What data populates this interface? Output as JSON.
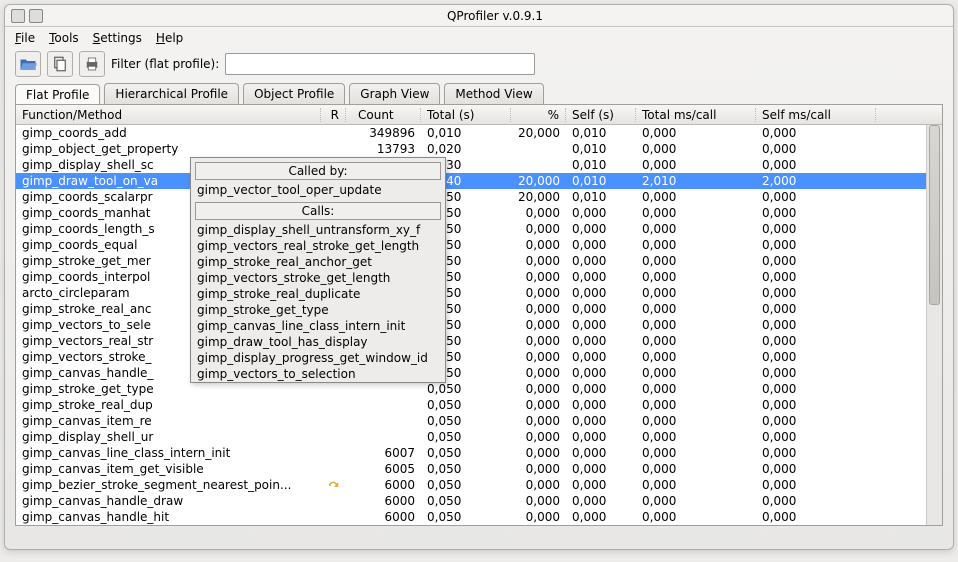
{
  "window": {
    "title": "QProfiler v.0.9.1"
  },
  "menu": {
    "file": "File",
    "tools": "Tools",
    "settings": "Settings",
    "help": "Help"
  },
  "toolbar": {
    "filter_label": "Filter (flat profile):",
    "filter_value": ""
  },
  "tabs": [
    {
      "label": "Flat Profile",
      "active": true
    },
    {
      "label": "Hierarchical Profile",
      "active": false
    },
    {
      "label": "Object Profile",
      "active": false
    },
    {
      "label": "Graph View",
      "active": false
    },
    {
      "label": "Method View",
      "active": false
    }
  ],
  "columns": [
    "Function/Method",
    "R",
    "Count",
    "Total (s)",
    "%",
    "Self (s)",
    "Total ms/call",
    "Self ms/call"
  ],
  "rows": [
    {
      "fn": "gimp_coords_add",
      "r": "",
      "count": "349896",
      "total": "0,010",
      "pct": "20,000",
      "self": "0,010",
      "tms": "0,000",
      "sms": "0,000",
      "sel": false
    },
    {
      "fn": "gimp_object_get_property",
      "r": "",
      "count": "13793",
      "total": "0,020",
      "pct": "",
      "self": "0,010",
      "tms": "0,000",
      "sms": "0,000",
      "sel": false
    },
    {
      "fn": "gimp_display_shell_sc",
      "r": "",
      "count": "",
      "total": "0,030",
      "pct": "",
      "self": "0,010",
      "tms": "0,000",
      "sms": "0,000",
      "sel": false
    },
    {
      "fn": "gimp_draw_tool_on_va",
      "r": "",
      "count": "",
      "total": "0,040",
      "pct": "20,000",
      "self": "0,010",
      "tms": "2,010",
      "sms": "2,000",
      "sel": true
    },
    {
      "fn": "gimp_coords_scalarpr",
      "r": "",
      "count": "",
      "total": "0,050",
      "pct": "20,000",
      "self": "0,010",
      "tms": "0,000",
      "sms": "0,000",
      "sel": false
    },
    {
      "fn": "gimp_coords_manhat",
      "r": "",
      "count": "",
      "total": "0,050",
      "pct": "0,000",
      "self": "0,000",
      "tms": "0,000",
      "sms": "0,000",
      "sel": false
    },
    {
      "fn": "gimp_coords_length_s",
      "r": "",
      "count": "",
      "total": "0,050",
      "pct": "0,000",
      "self": "0,000",
      "tms": "0,000",
      "sms": "0,000",
      "sel": false
    },
    {
      "fn": "gimp_coords_equal",
      "r": "",
      "count": "",
      "total": "0,050",
      "pct": "0,000",
      "self": "0,000",
      "tms": "0,000",
      "sms": "0,000",
      "sel": false
    },
    {
      "fn": "gimp_stroke_get_mer",
      "r": "",
      "count": "",
      "total": "0,050",
      "pct": "0,000",
      "self": "0,000",
      "tms": "0,000",
      "sms": "0,000",
      "sel": false
    },
    {
      "fn": "gimp_coords_interpol",
      "r": "",
      "count": "",
      "total": "0,050",
      "pct": "0,000",
      "self": "0,000",
      "tms": "0,000",
      "sms": "0,000",
      "sel": false
    },
    {
      "fn": "arcto_circleparam",
      "r": "",
      "count": "",
      "total": "0,050",
      "pct": "0,000",
      "self": "0,000",
      "tms": "0,000",
      "sms": "0,000",
      "sel": false
    },
    {
      "fn": "gimp_stroke_real_anc",
      "r": "",
      "count": "",
      "total": "0,050",
      "pct": "0,000",
      "self": "0,000",
      "tms": "0,000",
      "sms": "0,000",
      "sel": false
    },
    {
      "fn": "gimp_vectors_to_sele",
      "r": "",
      "count": "",
      "total": "0,050",
      "pct": "0,000",
      "self": "0,000",
      "tms": "0,000",
      "sms": "0,000",
      "sel": false
    },
    {
      "fn": "gimp_vectors_real_str",
      "r": "",
      "count": "",
      "total": "0,050",
      "pct": "0,000",
      "self": "0,000",
      "tms": "0,000",
      "sms": "0,000",
      "sel": false
    },
    {
      "fn": "gimp_vectors_stroke_",
      "r": "",
      "count": "",
      "total": "0,050",
      "pct": "0,000",
      "self": "0,000",
      "tms": "0,000",
      "sms": "0,000",
      "sel": false
    },
    {
      "fn": "gimp_canvas_handle_",
      "r": "",
      "count": "",
      "total": "0,050",
      "pct": "0,000",
      "self": "0,000",
      "tms": "0,000",
      "sms": "0,000",
      "sel": false
    },
    {
      "fn": "gimp_stroke_get_type",
      "r": "",
      "count": "",
      "total": "0,050",
      "pct": "0,000",
      "self": "0,000",
      "tms": "0,000",
      "sms": "0,000",
      "sel": false
    },
    {
      "fn": "gimp_stroke_real_dup",
      "r": "",
      "count": "",
      "total": "0,050",
      "pct": "0,000",
      "self": "0,000",
      "tms": "0,000",
      "sms": "0,000",
      "sel": false
    },
    {
      "fn": "gimp_canvas_item_re",
      "r": "",
      "count": "",
      "total": "0,050",
      "pct": "0,000",
      "self": "0,000",
      "tms": "0,000",
      "sms": "0,000",
      "sel": false
    },
    {
      "fn": "gimp_display_shell_ur",
      "r": "",
      "count": "",
      "total": "0,050",
      "pct": "0,000",
      "self": "0,000",
      "tms": "0,000",
      "sms": "0,000",
      "sel": false
    },
    {
      "fn": "gimp_canvas_line_class_intern_init",
      "r": "",
      "count": "6007",
      "total": "0,050",
      "pct": "0,000",
      "self": "0,000",
      "tms": "0,000",
      "sms": "0,000",
      "sel": false
    },
    {
      "fn": "gimp_canvas_item_get_visible",
      "r": "",
      "count": "6005",
      "total": "0,050",
      "pct": "0,000",
      "self": "0,000",
      "tms": "0,000",
      "sms": "0,000",
      "sel": false
    },
    {
      "fn": "gimp_bezier_stroke_segment_nearest_poin...",
      "r": "↻",
      "count": "6000",
      "total": "0,050",
      "pct": "0,000",
      "self": "0,000",
      "tms": "0,000",
      "sms": "0,000",
      "sel": false
    },
    {
      "fn": "gimp_canvas_handle_draw",
      "r": "",
      "count": "6000",
      "total": "0,050",
      "pct": "0,000",
      "self": "0,000",
      "tms": "0,000",
      "sms": "0,000",
      "sel": false
    },
    {
      "fn": "gimp_canvas_handle_hit",
      "r": "",
      "count": "6000",
      "total": "0,050",
      "pct": "0,000",
      "self": "0,000",
      "tms": "0,000",
      "sms": "0,000",
      "sel": false
    }
  ],
  "popup": {
    "called_by_header": "Called by:",
    "called_by": [
      "gimp_vector_tool_oper_update"
    ],
    "calls_header": "Calls:",
    "calls": [
      "gimp_display_shell_untransform_xy_f",
      "gimp_vectors_real_stroke_get_length",
      "gimp_stroke_real_anchor_get",
      "gimp_vectors_stroke_get_length",
      "gimp_stroke_real_duplicate",
      "gimp_stroke_get_type",
      "gimp_canvas_line_class_intern_init",
      "gimp_draw_tool_has_display",
      "gimp_display_progress_get_window_id",
      "gimp_vectors_to_selection"
    ]
  }
}
